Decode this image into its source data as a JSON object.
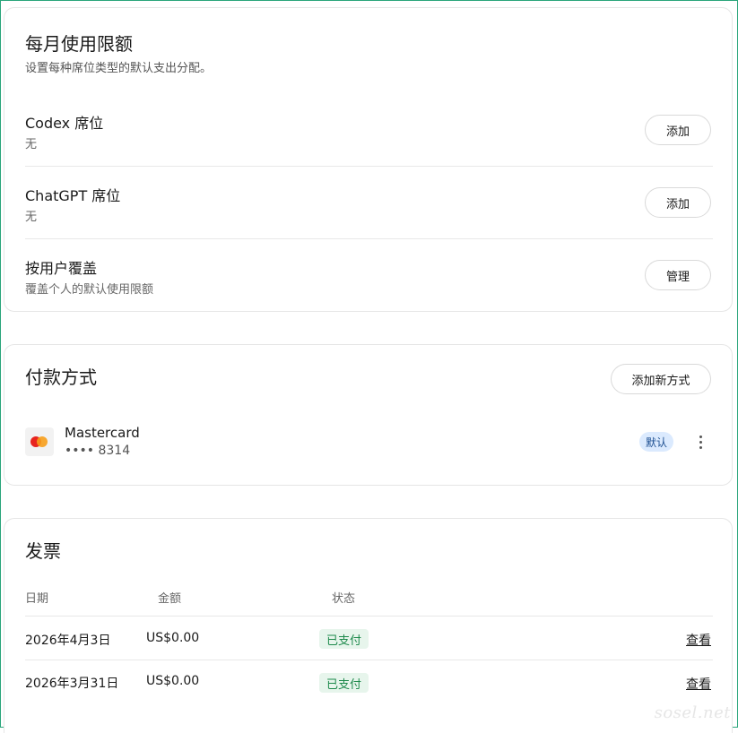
{
  "usage_limits": {
    "title": "每月使用限额",
    "subtitle": "设置每种席位类型的默认支出分配。",
    "rows": [
      {
        "title": "Codex 席位",
        "subtitle": "无",
        "button": "添加"
      },
      {
        "title": "ChatGPT 席位",
        "subtitle": "无",
        "button": "添加"
      },
      {
        "title": "按用户覆盖",
        "subtitle": "覆盖个人的默认使用限额",
        "button": "管理"
      }
    ]
  },
  "payment_methods": {
    "title": "付款方式",
    "add_button": "添加新方式",
    "methods": [
      {
        "brand": "Mastercard",
        "number": "•••• 8314",
        "badge": "默认",
        "icon": "mastercard-icon"
      }
    ]
  },
  "invoices": {
    "title": "发票",
    "columns": {
      "date": "日期",
      "amount": "金额",
      "status": "状态"
    },
    "rows": [
      {
        "date": "2026年4月3日",
        "amount": "US$0.00",
        "status": "已支付",
        "action": "查看"
      },
      {
        "date": "2026年3月31日",
        "amount": "US$0.00",
        "status": "已支付",
        "action": "查看"
      }
    ]
  },
  "watermark": "sosel.net",
  "colors": {
    "accent_frame": "#2aa57a",
    "badge_default_bg": "#dbeafe",
    "paid_bg": "#e7f5ec",
    "paid_text": "#1e8a4c"
  }
}
